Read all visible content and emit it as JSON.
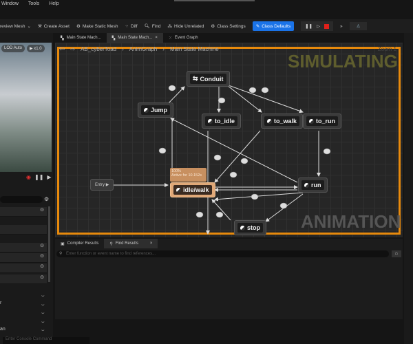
{
  "menu": [
    "Window",
    "Tools",
    "Help"
  ],
  "toolbar": {
    "preview_mesh": "review Mesh",
    "create_asset": "Create Asset",
    "make_static_mesh": "Make Static Mesh",
    "diff": "Diff",
    "find": "Find",
    "hide_unrelated": "Hide Unrelated",
    "class_settings": "Class Settings",
    "class_defaults": "Class Defaults"
  },
  "viewport": {
    "lod": "LOD Auto",
    "speed": "x1.0"
  },
  "tabs": [
    {
      "label": "Main State Mach..."
    },
    {
      "label": "Main State Mach..."
    },
    {
      "label": "Event Graph"
    }
  ],
  "breadcrumb": {
    "asset": "AB_cyberToad",
    "graph": "AnimGraph",
    "state_machine": "Main State Machine",
    "zoom": "Zoom 1"
  },
  "watermarks": {
    "top": "SIMULATING",
    "bottom": "ANIMATION"
  },
  "nodes": {
    "entry": "Entry",
    "conduit": "Conduit",
    "jump": "Jump",
    "to_idle": "to_idle",
    "to_walk": "to_walk",
    "to_run": "to_run",
    "idle_walk": "idle/walk",
    "run": "run",
    "stop": "stop"
  },
  "active_state": {
    "weight": "100%",
    "time": "Active for 10.152s"
  },
  "bottom": {
    "tab_compiler": "Compiler Results",
    "tab_find": "Find Results",
    "find_placeholder": "Enter function or event name to find references..."
  },
  "left_panel": {
    "labels": [
      "r",
      "an"
    ]
  },
  "console": {
    "placeholder": "Enter Console Command"
  },
  "colors": {
    "accent": "#1a73e8",
    "frame": "#e88a0c",
    "active_node": "#e0a878"
  }
}
